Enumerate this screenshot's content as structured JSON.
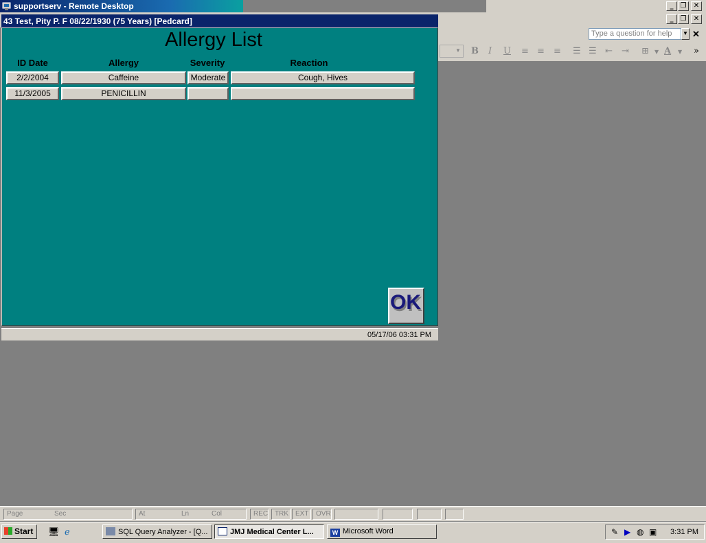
{
  "remote_desktop": {
    "title": "supportserv - Remote Desktop",
    "min_icon": "minimize-icon",
    "max_icon": "restore-icon",
    "close_icon": "close-icon"
  },
  "word": {
    "help_placeholder": "Type a question for help",
    "toolbar_glyphs": {
      "bold": "B",
      "italic": "I",
      "underline": "U",
      "font_color": "A"
    },
    "status": {
      "page": "Page",
      "sec": "Sec",
      "at": "At",
      "ln": "Ln",
      "col": "Col",
      "rec": "REC",
      "trk": "TRK",
      "ext": "EXT",
      "ovr": "OVR"
    }
  },
  "dialog": {
    "title": "43 Test, Pity P.  F  08/22/1930 (75 Years)  [Pedcard]",
    "heading": "Allergy List",
    "columns": {
      "id_date": "ID Date",
      "allergy": "Allergy",
      "severity": "Severity",
      "reaction": "Reaction"
    },
    "rows": [
      {
        "id_date": "2/2/2004",
        "allergy": "Caffeine",
        "severity": "Moderate",
        "reaction": "Cough, Hives"
      },
      {
        "id_date": "11/3/2005",
        "allergy": "PENICILLIN",
        "severity": "",
        "reaction": ""
      }
    ],
    "ok_label": "OK",
    "status_time": "05/17/06  03:31 PM"
  },
  "taskbar": {
    "start_label": "Start",
    "tasks": [
      {
        "label": "SQL Query Analyzer - [Q...",
        "active": false
      },
      {
        "label": "JMJ Medical Center  L...",
        "active": true
      },
      {
        "label": "Microsoft Word",
        "active": false
      }
    ],
    "clock": "3:31 PM"
  },
  "colors": {
    "dialog_bg": "#008080",
    "title_active": "#0a246a",
    "chrome": "#d4d0c8",
    "desktop": "#808080"
  }
}
